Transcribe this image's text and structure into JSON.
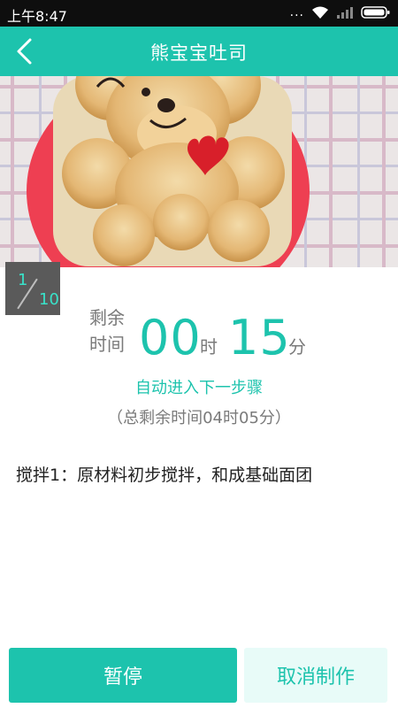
{
  "status_bar": {
    "time": "上午8:47",
    "dots": "...",
    "icons": [
      "wifi-icon",
      "signal-icon",
      "battery-icon"
    ]
  },
  "header": {
    "title": "熊宝宝吐司",
    "back_icon": "chevron-left-icon"
  },
  "step": {
    "current": "1",
    "total": "10"
  },
  "timer": {
    "label_line1": "剩余",
    "label_line2": "时间",
    "hours": "00",
    "hour_unit": "时",
    "minutes": "15",
    "minute_unit": "分"
  },
  "auto_next": "自动进入下一步骤",
  "total_remaining": "（总剩余时间04时05分）",
  "step_description": "搅拌1：原材料初步搅拌，和成基础面团",
  "buttons": {
    "pause": "暂停",
    "cancel": "取消制作"
  },
  "colors": {
    "accent": "#1dc3ad",
    "status_bar": "#0e0e0e"
  }
}
